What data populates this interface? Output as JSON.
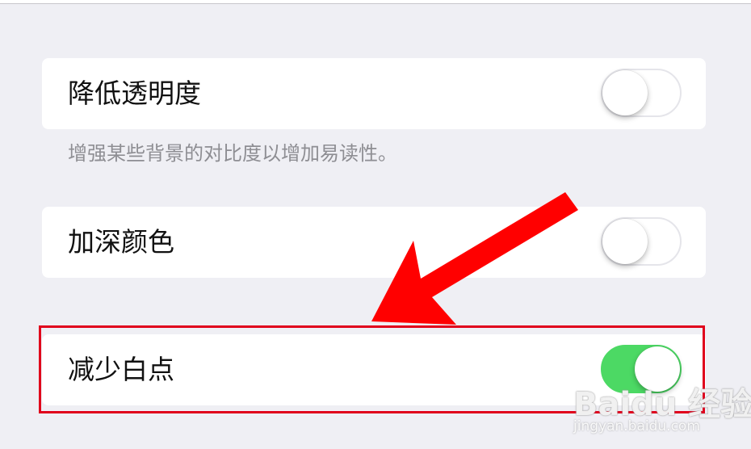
{
  "settings": {
    "reduce_transparency": {
      "label": "降低透明度",
      "state": "off"
    },
    "reduce_transparency_footnote": "增强某些背景的对比度以增加易读性。",
    "darken_colors": {
      "label": "加深颜色",
      "state": "off"
    },
    "reduce_white_point": {
      "label": "减少白点",
      "state": "on"
    }
  },
  "annotation": {
    "highlight_color": "#e0001b",
    "arrow_color": "#ff0000",
    "target": "reduce_white_point"
  },
  "watermark": {
    "brand": "Baidu 经验",
    "url": "jingyan.baidu.com"
  },
  "colors": {
    "background": "#efeff4",
    "toggle_on": "#4cd964",
    "toggle_off_border": "#e5e5ea",
    "footnote": "#8e8e93"
  }
}
